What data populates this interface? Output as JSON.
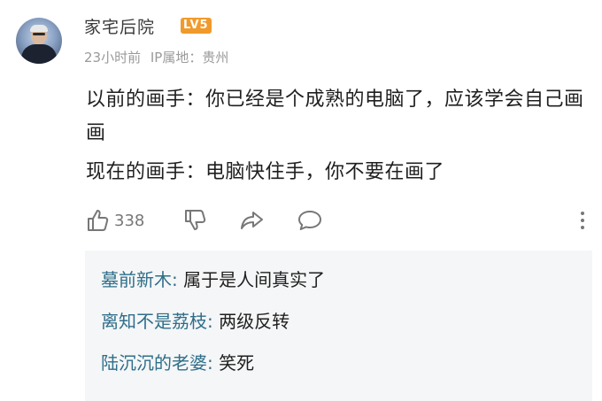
{
  "comment": {
    "username": "家宅后院",
    "level_badge": "LV5",
    "time": "23小时前",
    "ip_location": "IP属地：贵州",
    "lines": [
      "以前的画手：你已经是个成熟的电脑了，应该学会自己画画",
      "现在的画手：电脑快住手，你不要在画了"
    ],
    "like_count": "338"
  },
  "icons": [
    "avatar",
    "thumbs-up-icon",
    "thumbs-down-icon",
    "share-icon",
    "reply-bubble-icon",
    "more-vertical-icon"
  ],
  "replies": [
    {
      "name": "墓前新木",
      "separator": ":",
      "text": " 属于是人间真实了"
    },
    {
      "name": "离知不是荔枝",
      "separator": ":",
      "text": " 两级反转"
    },
    {
      "name": "陆沉沉的老婆",
      "separator": ":",
      "text": " 笑死"
    }
  ],
  "colors": {
    "reply_name": "#2f6e8a",
    "level_badge": "#f19a2c",
    "reply_background": "#f5f6f7",
    "meta_text": "#9a9a9a"
  }
}
